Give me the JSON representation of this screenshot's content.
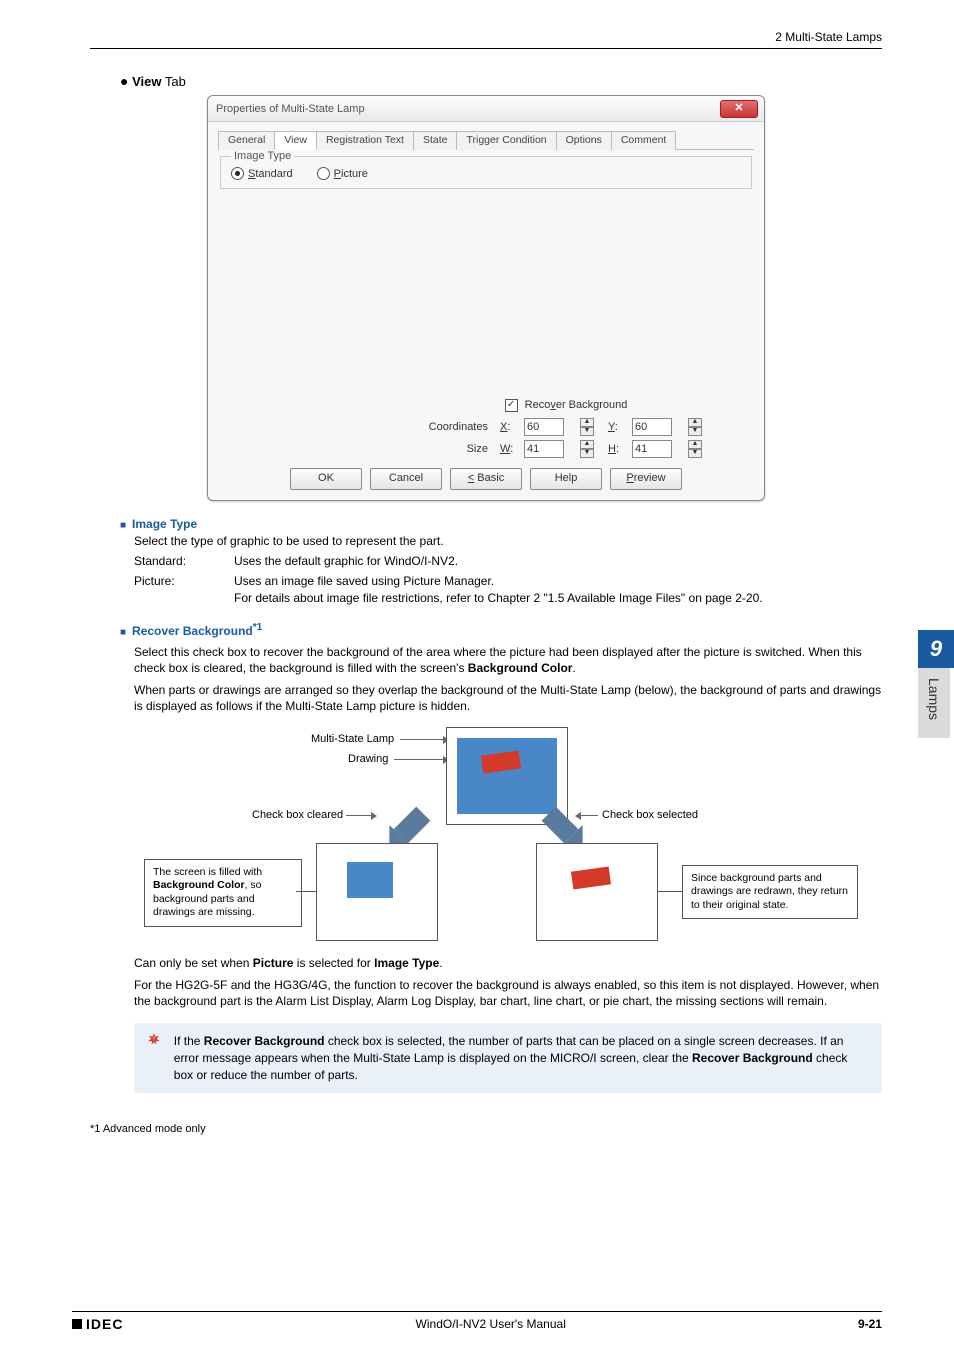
{
  "header": {
    "right": "2 Multi-State Lamps"
  },
  "heading": {
    "bullet": "●",
    "strong": "View",
    "rest": " Tab"
  },
  "dialog": {
    "title": "Properties of Multi-State Lamp",
    "close": "✕",
    "tabs": [
      "General",
      "View",
      "Registration Text",
      "State",
      "Trigger Condition",
      "Options",
      "Comment"
    ],
    "selected_tab": "View",
    "fieldset_legend": "Image Type",
    "radio_standard_u": "S",
    "radio_standard_rest": "tandard",
    "radio_picture_u": "P",
    "radio_picture_rest": "icture",
    "recover_cb_checked": "✓",
    "recover_u": "v",
    "recover_pre": "Reco",
    "recover_post": "er Background",
    "coord_label": "Coordinates",
    "size_label": "Size",
    "x_u": "X",
    "x_post": ":",
    "x_val": "60",
    "y_u": "Y",
    "y_post": ":",
    "y_val": "60",
    "w_u": "W",
    "w_post": ":",
    "w_val": "41",
    "h_u": "H",
    "h_post": ":",
    "h_val": "41",
    "btn_ok": "OK",
    "btn_cancel": "Cancel",
    "btn_basic_u": "<",
    "btn_basic_rest": " Basic",
    "btn_help": "Help",
    "btn_preview_u": "P",
    "btn_preview_rest": "review"
  },
  "sidetab": {
    "num": "9",
    "text": "Lamps"
  },
  "image_type": {
    "title": "Image Type",
    "lead": "Select the type of graphic to be used to represent the part.",
    "rows": [
      {
        "term": "Standard:",
        "def": "Uses the default graphic for WindO/I-NV2."
      },
      {
        "term": "Picture:",
        "def": "Uses an image file saved using Picture Manager.\nFor details about image file restrictions, refer to Chapter 2 \"1.5 Available Image Files\" on page 2-20."
      }
    ]
  },
  "recover": {
    "title": "Recover Background",
    "sup": "*1",
    "p1": "Select this check box to recover the background of the area where the picture had been displayed after the picture is switched. When this check box is cleared, the background is filled with the screen's ",
    "p1_strong": "Background Color",
    "p1_end": ".",
    "p2": "When parts or drawings are arranged so they overlap the background of the Multi-State Lamp (below), the background of parts and drawings is displayed as follows if the Multi-State Lamp picture is hidden."
  },
  "diagram": {
    "lbl_lamp": "Multi-State Lamp",
    "lbl_drawing": "Drawing",
    "lbl_cleared": "Check box cleared",
    "lbl_selected": "Check box selected",
    "callout_left": "The screen is filled with Background Color, so background parts and drawings are missing.",
    "callout_left_bold": "Background Color",
    "callout_right": "Since background parts and drawings are redrawn, they return to their original state."
  },
  "after": {
    "p1_a": "Can only be set when ",
    "p1_b": "Picture",
    "p1_c": " is selected for ",
    "p1_d": "Image Type",
    "p1_e": ".",
    "p2": "For the HG2G-5F and the HG3G/4G, the function to recover the background is always enabled, so this item is not displayed. However, when the background part is the Alarm List Display, Alarm Log Display, bar chart, line chart, or pie chart, the missing sections will remain."
  },
  "warn": {
    "t1": "If the ",
    "b1": "Recover Background",
    "t2": " check box is selected, the number of parts that can be placed on a single screen decreases. If an error message appears when the Multi-State Lamp is displayed on the MICRO/I screen, clear the ",
    "b2": "Recover Background",
    "t3": " check box or reduce the number of parts."
  },
  "footnote": "*1  Advanced mode only",
  "footer": {
    "logo": "IDEC",
    "center": "WindO/I-NV2 User's Manual",
    "page": "9-21"
  }
}
